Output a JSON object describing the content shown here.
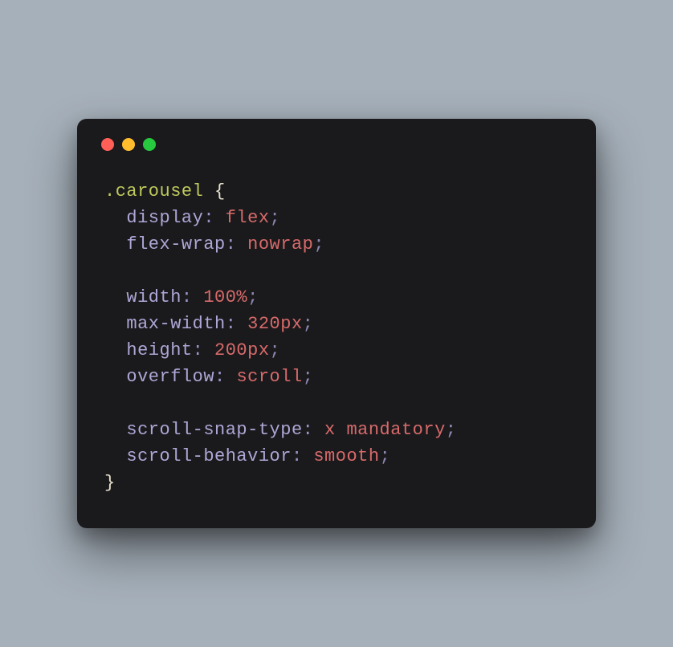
{
  "traffic_lights": {
    "red": "#ff5f56",
    "yellow": "#ffbd2e",
    "green": "#27c93f"
  },
  "code": {
    "selector": ".carousel",
    "brace_open": "{",
    "brace_close": "}",
    "lines": [
      {
        "prop": "display",
        "val": "flex"
      },
      {
        "prop": "flex-wrap",
        "val": "nowrap"
      },
      null,
      {
        "prop": "width",
        "val": "100%"
      },
      {
        "prop": "max-width",
        "val": "320px"
      },
      {
        "prop": "height",
        "val": "200px"
      },
      {
        "prop": "overflow",
        "val": "scroll"
      },
      null,
      {
        "prop": "scroll-snap-type",
        "val": "x mandatory"
      },
      {
        "prop": "scroll-behavior",
        "val": "smooth"
      }
    ],
    "colon": ":",
    "semi": ";",
    "indent": "  "
  }
}
